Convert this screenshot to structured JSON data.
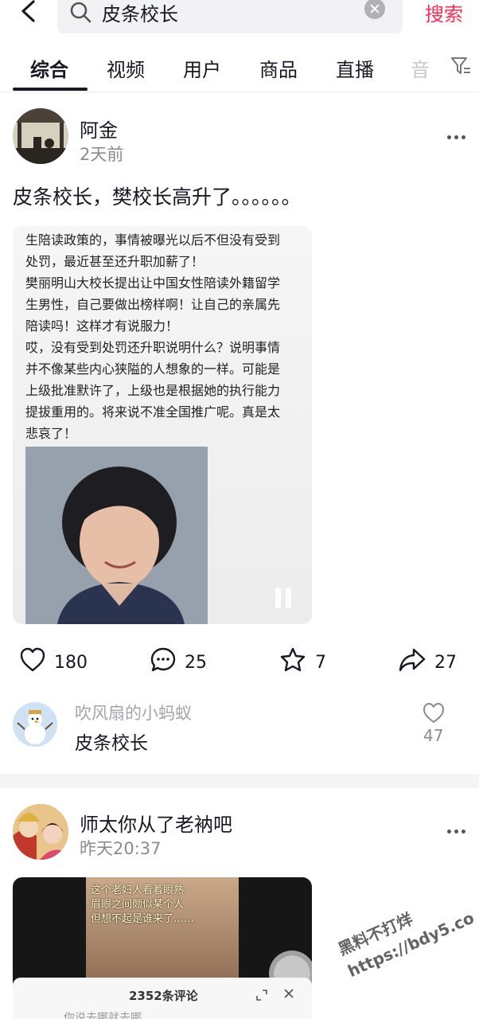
{
  "search": {
    "query": "皮条校长",
    "submit_label": "搜索"
  },
  "tabs": [
    "综合",
    "视频",
    "用户",
    "商品",
    "直播",
    "音"
  ],
  "posts": [
    {
      "author": "阿金",
      "time": "2天前",
      "text": "皮条校长，樊校长高升了。。。。。。",
      "media_lines": [
        "生陪读政策的，事情被曝光以后不但没有受到",
        "处罚，最近甚至还升职加薪了！",
        "樊丽明山大校长提出让中国女性陪读外籍留学",
        "生男性，自己要做出榜样啊！让自己的亲属先",
        "陪读吗！这样才有说服力！",
        "哎，没有受到处罚还升职说明什么？说明事情",
        "并不像某些内心狭隘的人想象的一样。可能是",
        "上级批准默许了，上级也是根据她的执行能力",
        "提拔重用的。将来说不准全国推广呢。真是太",
        "悲哀了！"
      ],
      "likes": "180",
      "comments": "25",
      "favorites": "7",
      "shares": "27",
      "top_comment": {
        "user": "吹风扇的小蚂蚁",
        "text": "皮条校长",
        "likes": "47"
      }
    },
    {
      "author": "师太你从了老衲吧",
      "time": "昨天20:37",
      "video_caption": [
        "这个老妇人看着眼熟",
        "眉眼之间颇似某个人",
        "但想不起是谁来了……"
      ],
      "comment_panel": {
        "title": "2352条评论",
        "preview": "你说去哪就去哪"
      }
    }
  ],
  "watermark": {
    "line1": "黑料不打烊",
    "line2": "https://bdy5.co"
  },
  "colors": {
    "accent": "#fe2c55",
    "text": "#161823",
    "muted": "#8a8b91"
  },
  "icons": [
    "back-arrow-icon",
    "search-icon",
    "clear-icon",
    "filter-icon",
    "more-icon",
    "heart-icon",
    "comment-icon",
    "star-icon",
    "share-icon",
    "pause-icon",
    "expand-icon",
    "close-icon"
  ]
}
